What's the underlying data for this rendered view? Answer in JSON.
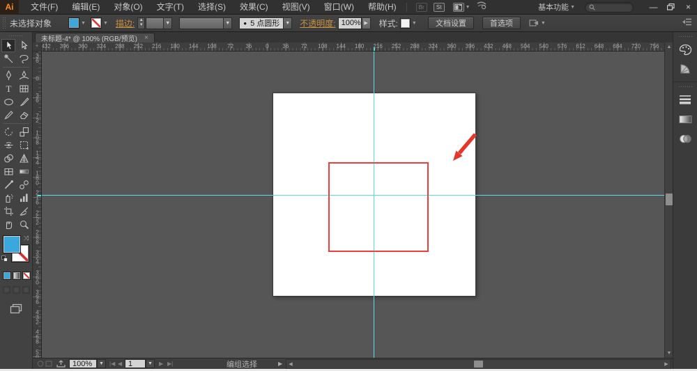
{
  "titlebar": {
    "logo": "Ai",
    "menus": [
      "文件(F)",
      "编辑(E)",
      "对象(O)",
      "文字(T)",
      "选择(S)",
      "效果(C)",
      "视图(V)",
      "窗口(W)",
      "帮助(H)"
    ],
    "bridge_label": "Br",
    "stock_label": "St",
    "workspace_label": "基本功能",
    "search_value": "",
    "window": {
      "minimize": "—",
      "close": "×"
    }
  },
  "control_bar": {
    "selection_status": "未选择对象",
    "stroke_label": "描边:",
    "brush_bullet": "●",
    "brush_definition": "5 点圆形",
    "opacity_label": "不透明度:",
    "opacity_value": "100%",
    "style_label": "样式:",
    "document_setup_label": "文档设置",
    "preferences_label": "首选项"
  },
  "document_tab": {
    "title": "未标题-4* @ 100% (RGB/预览)",
    "close_glyph": "×"
  },
  "rulers": {
    "horizontal_labels": [
      432,
      396,
      360,
      324,
      288,
      252,
      216,
      180,
      144,
      108,
      72,
      36,
      0,
      36,
      72,
      108,
      144,
      180,
      216,
      252,
      288,
      324,
      360,
      396,
      432,
      468,
      504,
      540,
      576,
      612,
      648,
      684,
      720,
      756
    ],
    "vertical_labels": [
      36,
      0,
      36,
      72,
      108,
      144,
      180,
      216,
      252,
      288,
      324,
      360,
      396,
      432,
      468,
      504
    ]
  },
  "status_bar": {
    "zoom_value": "100%",
    "artboard_value": "1",
    "tool_name": "编组选择"
  },
  "colors": {
    "fill_swatch": "#3aa8dc",
    "rectangle_stroke": "#f23b3b",
    "guide": "#50e1e5",
    "annotation_arrow": "#e6352b",
    "label_accent": "#c9913f"
  }
}
